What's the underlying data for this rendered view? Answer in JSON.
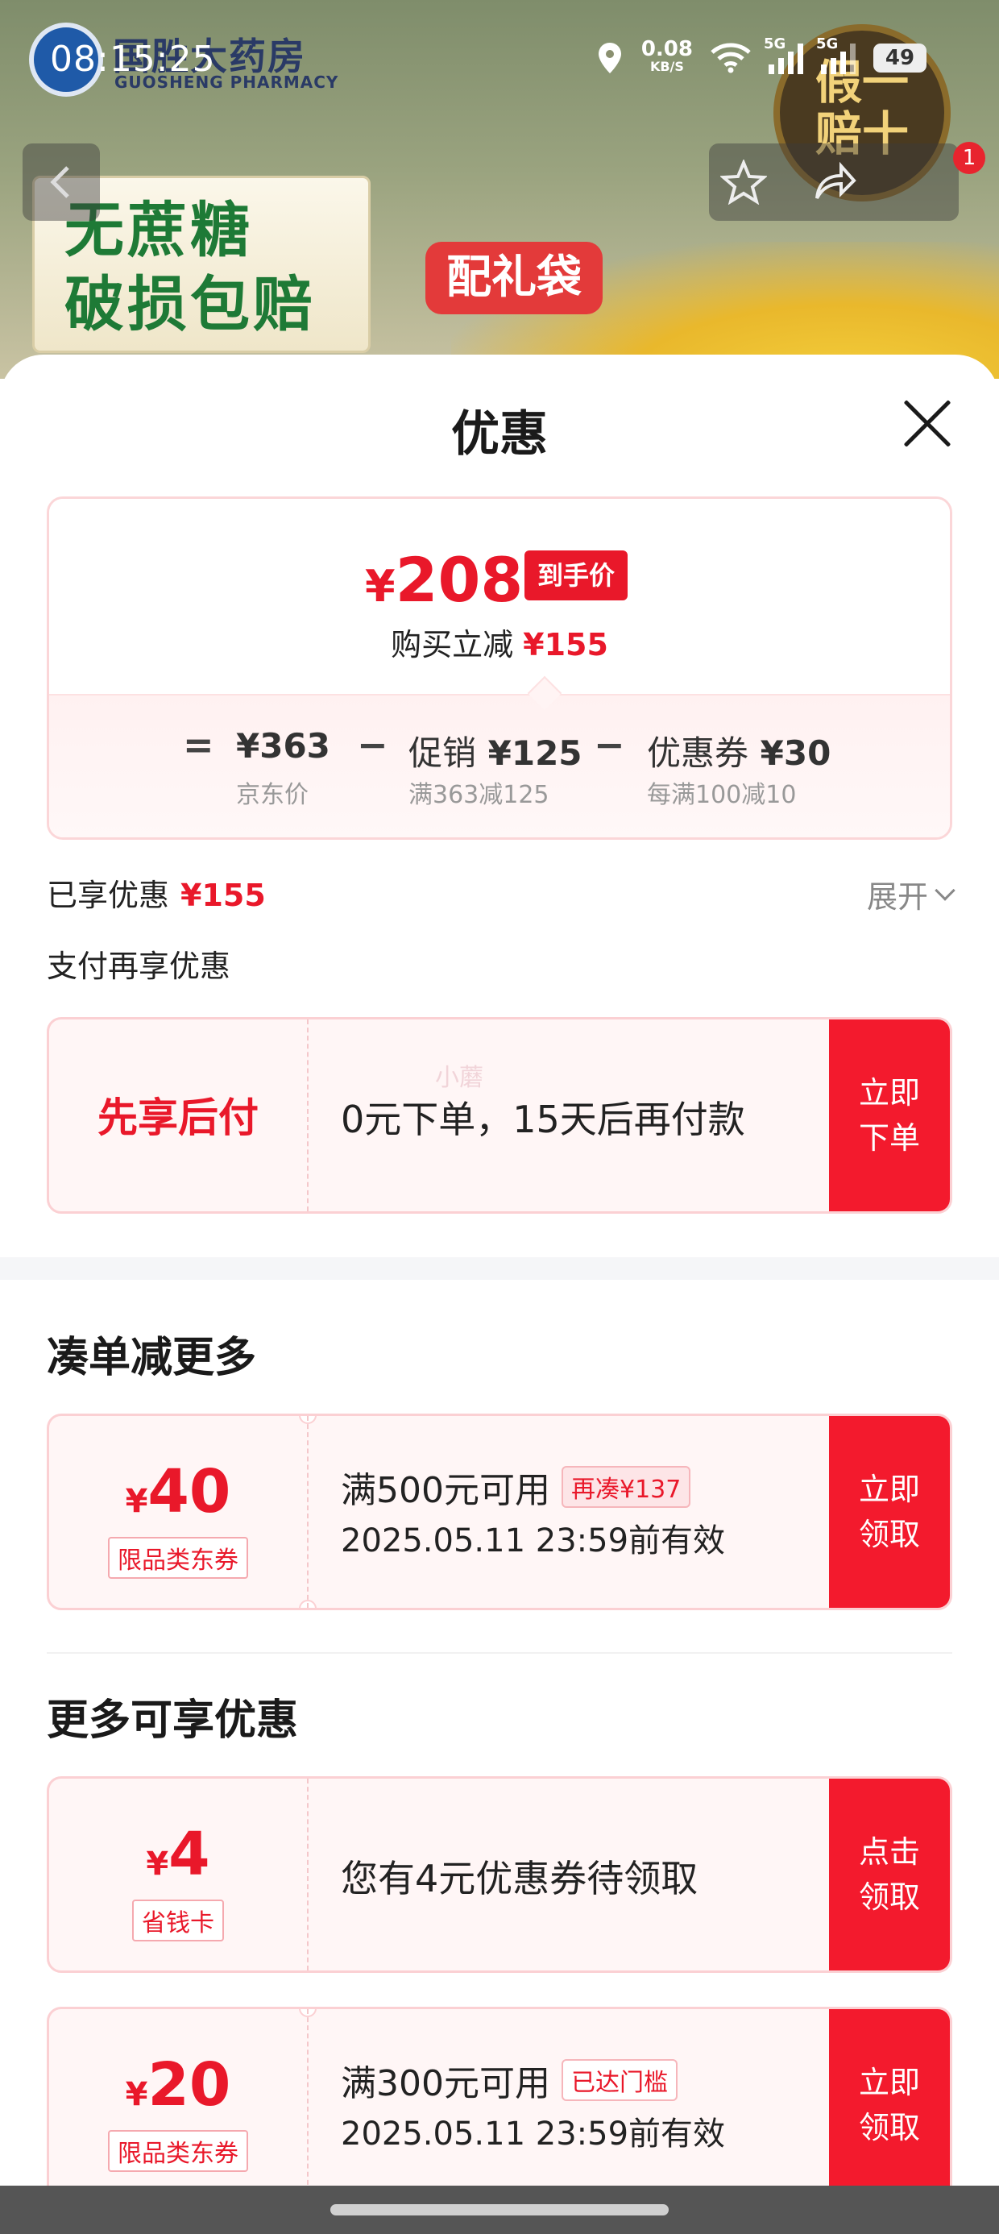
{
  "status_bar": {
    "time": "08:15:25",
    "net_speed": "0.08",
    "net_unit": "KB/S",
    "sim1": "5G",
    "sim2": "5G",
    "battery": "49"
  },
  "banner": {
    "brand_cn": "国胜大药房",
    "brand_en": "GUOSHENG PHARMACY",
    "promo_line1": "无蔗糖",
    "promo_line2": "破损包赔",
    "gift_bag": "配礼袋",
    "seal_text": "假一赔十",
    "cart_badge": "1",
    "icons": [
      "back-icon",
      "star-icon",
      "share-icon"
    ]
  },
  "sheet": {
    "title": "优惠",
    "price": {
      "currency": "¥",
      "final": "208",
      "final_tag": "到手价",
      "reduce_label": "购买立减",
      "reduce_value": "¥155",
      "equals": "=",
      "minus": "−",
      "jd_price": "¥363",
      "jd_label": "京东价",
      "promo_label": "促销",
      "promo_value": "¥125",
      "promo_rule": "满363减125",
      "coupon_label": "优惠券",
      "coupon_value": "¥30",
      "coupon_rule": "每满100减10"
    },
    "enjoyed_label": "已享优惠",
    "enjoyed_value": "¥155",
    "expand_label": "展开",
    "pay_more_label": "支付再享优惠",
    "pay_later": {
      "title": "先享后付",
      "desc": "0元下单，15天后再付款",
      "cta": "立即下单",
      "watermark": "小蘑"
    },
    "bundle_section_title": "凑单减更多",
    "bundle_coupon": {
      "currency": "¥",
      "amount": "40",
      "type": "限品类东券",
      "condition": "满500元可用",
      "tag": "再凑¥137",
      "expiry": "2025.05.11 23:59前有效",
      "cta": "立即领取"
    },
    "more_section_title": "更多可享优惠",
    "saver_card": {
      "currency": "¥",
      "amount": "4",
      "type": "省钱卡",
      "desc": "您有4元优惠券待领取",
      "cta": "点击领取"
    },
    "coupon_20": {
      "currency": "¥",
      "amount": "20",
      "type": "限品类东券",
      "condition": "满300元可用",
      "tag": "已达门槛",
      "expiry": "2025.05.11 23:59前有效",
      "cta": "立即领取"
    }
  },
  "colors": {
    "accent_red": "#e9182a",
    "cta_red": "#f31a2d",
    "card_bg": "#fff6f6"
  }
}
